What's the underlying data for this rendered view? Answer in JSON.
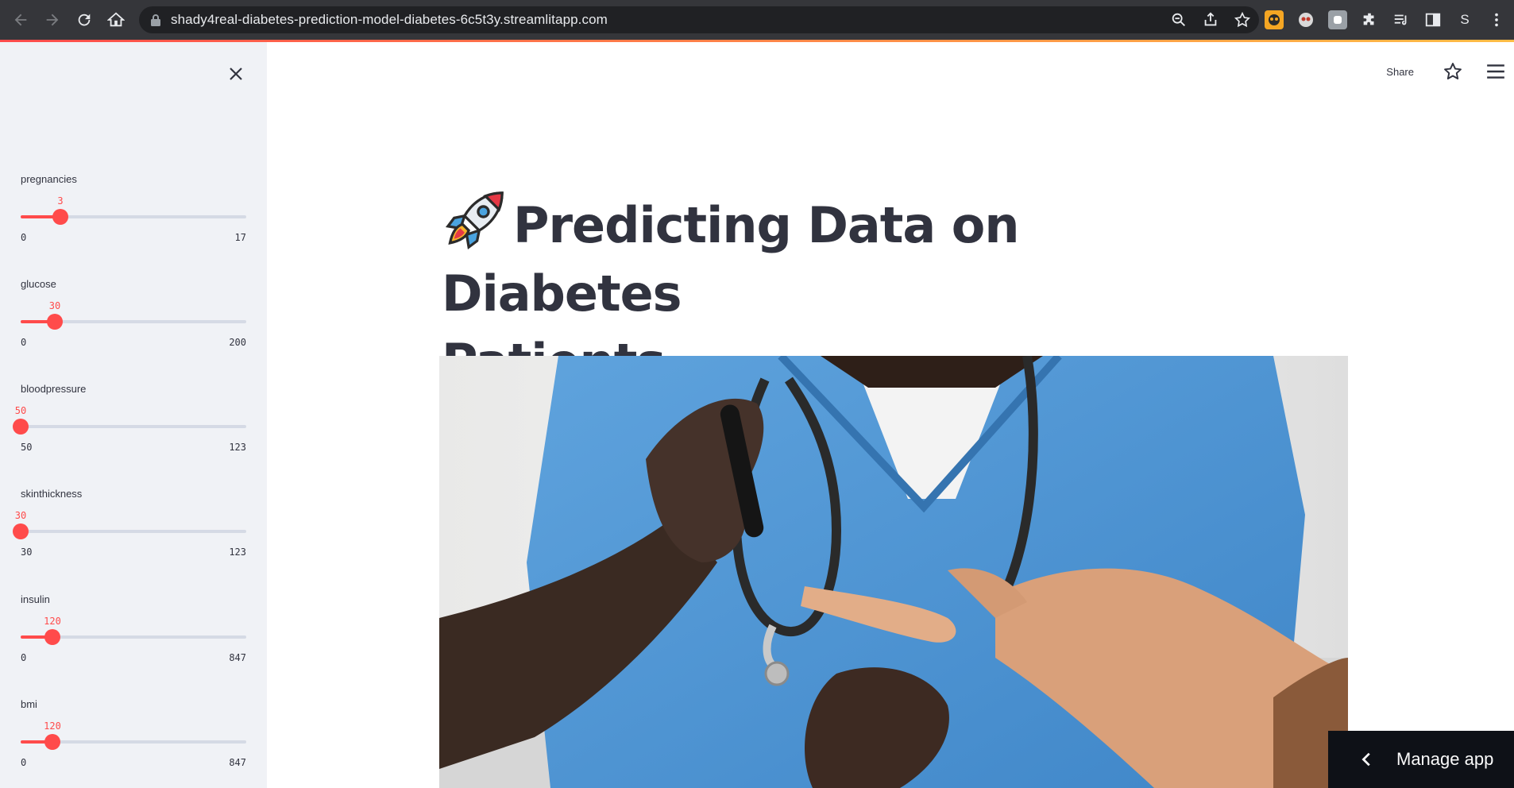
{
  "browser": {
    "url": "shady4real-diabetes-prediction-model-diabetes-6c5t3y.streamlitapp.com",
    "profile_initial": "S"
  },
  "sidebar": {
    "sliders": [
      {
        "label": "pregnancies",
        "value": "3",
        "min": "0",
        "max": "17",
        "fraction": 0.176
      },
      {
        "label": "glucose",
        "value": "30",
        "min": "0",
        "max": "200",
        "fraction": 0.15
      },
      {
        "label": "bloodpressure",
        "value": "50",
        "min": "50",
        "max": "123",
        "fraction": 0.0
      },
      {
        "label": "skinthickness",
        "value": "30",
        "min": "30",
        "max": "123",
        "fraction": 0.0
      },
      {
        "label": "insulin",
        "value": "120",
        "min": "0",
        "max": "847",
        "fraction": 0.142
      },
      {
        "label": "bmi",
        "value": "120",
        "min": "0",
        "max": "847",
        "fraction": 0.142
      }
    ]
  },
  "main": {
    "share_label": "Share",
    "title_line1": "Predicting Data on Diabetes",
    "title_line2": "Patients"
  },
  "footer": {
    "manage_app_label": "Manage app"
  },
  "colors": {
    "accent": "#ff4b4b",
    "sidebar_bg": "#f0f2f6",
    "text": "#31333f"
  }
}
